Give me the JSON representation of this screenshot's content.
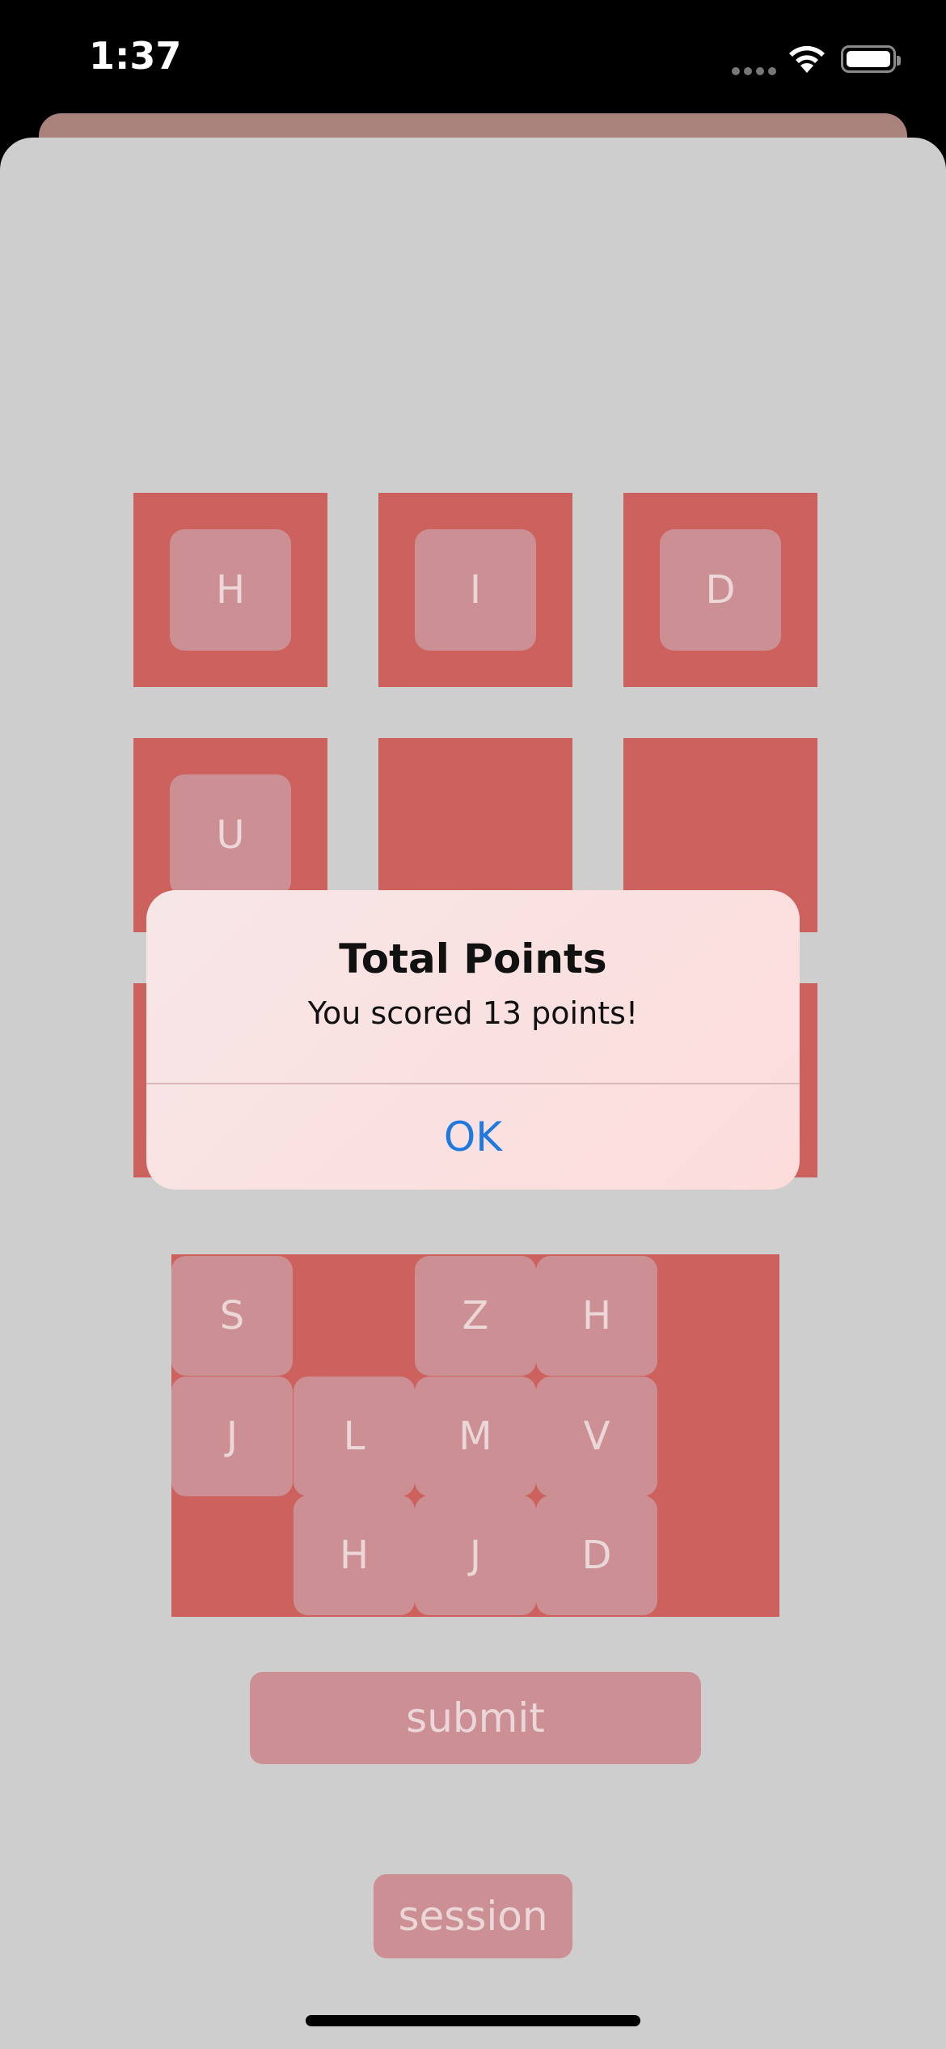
{
  "status_bar": {
    "time": "1:37"
  },
  "board": {
    "rows": [
      [
        "H",
        "I",
        "D"
      ],
      [
        "U",
        "",
        ""
      ],
      [
        "",
        "",
        ""
      ]
    ]
  },
  "rack": {
    "rows": [
      [
        "S",
        "",
        "Z",
        "H",
        ""
      ],
      [
        "J",
        "L",
        "M",
        "V",
        ""
      ],
      [
        "",
        "H",
        "J",
        "D",
        ""
      ]
    ]
  },
  "buttons": {
    "submit": "submit",
    "session": "session"
  },
  "alert": {
    "title": "Total Points",
    "message": "You scored 13 points!",
    "ok": "OK"
  },
  "colors": {
    "slot": "#cc615d",
    "tile": "#cc9094",
    "sheet": "#cecece",
    "link": "#1f7ae0"
  }
}
